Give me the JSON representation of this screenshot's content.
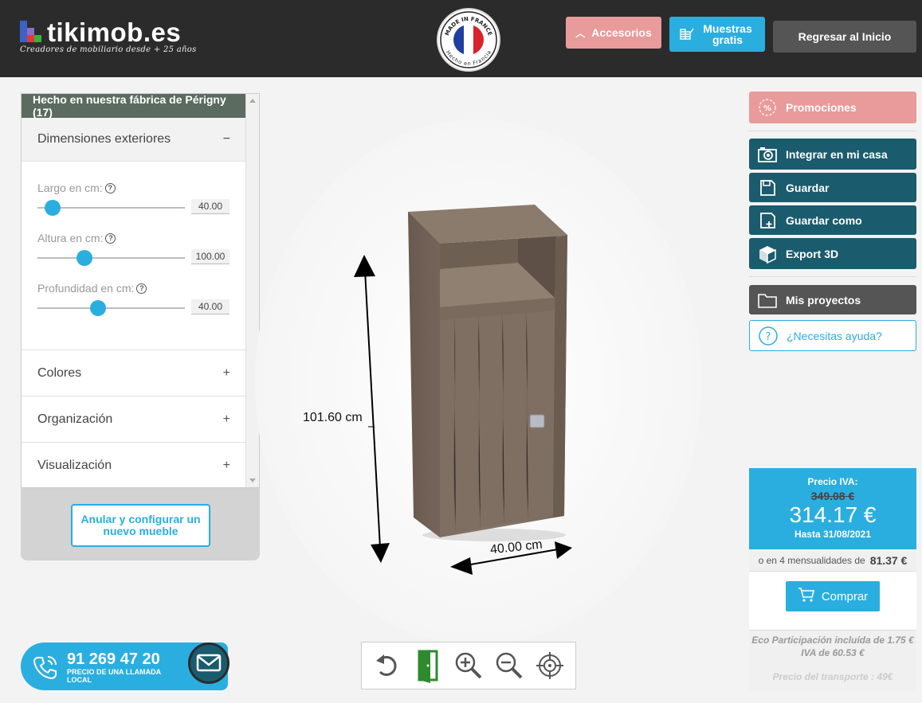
{
  "header": {
    "logo_text": "tikimob.es",
    "tagline": "Creadores de mobiliario desde + 25 años",
    "badge_top": "MADE IN FRANCE",
    "badge_bottom": "Hecho en Francia",
    "buttons": {
      "accesorios": "Accesorios",
      "muestras": "Muestras gratis",
      "regresar": "Regresar al Inicio"
    }
  },
  "left_panel": {
    "header": "Hecho en nuestra fábrica de Périgny (17)",
    "open_section": {
      "label": "Dimensiones exteriores",
      "toggle": "−"
    },
    "sliders": [
      {
        "label": "Largo en cm:",
        "value": "40.00",
        "fraction": 0.1
      },
      {
        "label": "Altura en cm:",
        "value": "100.00",
        "fraction": 0.32
      },
      {
        "label": "Profundidad en cm:",
        "value": "40.00",
        "fraction": 0.41
      }
    ],
    "sections": [
      {
        "label": "Colores",
        "toggle": "+"
      },
      {
        "label": "Organización",
        "toggle": "+"
      },
      {
        "label": "Visualización",
        "toggle": "+"
      }
    ],
    "reset_button": "Anular y configurar un nuevo mueble"
  },
  "phone": {
    "number": "91 269 47 20",
    "subtitle": "PRECIO DE UNA LLAMADA LOCAL"
  },
  "scene": {
    "height_label": "101.60 cm",
    "width_label": "40.00 cm",
    "cabinet_color": "#7a6a5c"
  },
  "toolbar": [
    "rotate-icon",
    "door-icon",
    "zoom-in-icon",
    "zoom-out-icon",
    "target-icon"
  ],
  "right_panel": {
    "promociones": "Promociones",
    "integrar": "Integrar en mi casa",
    "guardar": "Guardar",
    "guardar_como": "Guardar como",
    "export": "Export 3D",
    "proyectos": "Mis proyectos",
    "ayuda": "¿Necesitas ayuda?"
  },
  "price": {
    "label": "Precio IVA:",
    "old": "349.08 €",
    "new": "314.17 €",
    "until": "Hasta 31/08/2021",
    "monthly_text": "o en 4 mensualidades de",
    "monthly_value": "81.37 €",
    "buy": "Comprar",
    "eco": "Eco Participación incluída de 1.75 €",
    "iva": "IVA de 60.53 €",
    "transport": "Precio del transporte : 49€"
  },
  "colors": {
    "accent": "#2aaee0",
    "dark_teal": "#1b5b6e",
    "pink": "#e99a9a",
    "header_bg": "#2b2b2b"
  }
}
